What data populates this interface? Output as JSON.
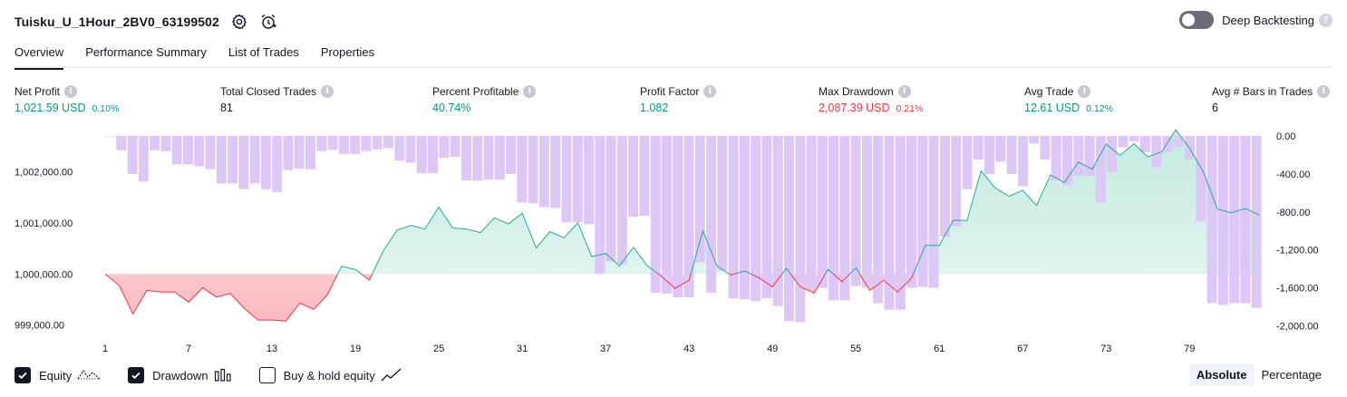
{
  "header": {
    "title": "Tuisku_U_1Hour_2BV0_63199502",
    "icons": [
      "settings-gear-icon",
      "alarm-add-icon"
    ]
  },
  "deep_backtesting": {
    "label": "Deep Backtesting",
    "enabled": false,
    "help_icon": "question-icon"
  },
  "tabs": [
    "Overview",
    "Performance Summary",
    "List of Trades",
    "Properties"
  ],
  "active_tab": "Overview",
  "metrics": [
    {
      "label": "Net Profit",
      "value": "1,021.59 USD",
      "pct": "0.10%",
      "color": "#089981"
    },
    {
      "label": "Total Closed Trades",
      "value": "81",
      "pct": "",
      "color": "#131722"
    },
    {
      "label": "Percent Profitable",
      "value": "40.74%",
      "pct": "",
      "color": "#089981"
    },
    {
      "label": "Profit Factor",
      "value": "1.082",
      "pct": "",
      "color": "#089981"
    },
    {
      "label": "Max Drawdown",
      "value": "2,087.39 USD",
      "pct": "0.21%",
      "color": "#f23645"
    },
    {
      "label": "Avg Trade",
      "value": "12.61 USD",
      "pct": "0.12%",
      "color": "#089981"
    },
    {
      "label": "Avg # Bars in Trades",
      "value": "6",
      "pct": "",
      "color": "#131722"
    }
  ],
  "chart_data": {
    "type": "line",
    "baseline": 1000000,
    "left_axis": {
      "ticks": [
        999000,
        1000000,
        1001000,
        1002000
      ],
      "tick_labels": [
        "999,000.00",
        "1,000,000.00",
        "1,001,000.00",
        "1,002,000.00"
      ],
      "range": [
        998800,
        1002700
      ]
    },
    "right_axis": {
      "ticks": [
        0,
        -400,
        -800,
        -1200,
        -1600,
        -2000
      ],
      "tick_labels": [
        "0.00",
        "-400.00",
        "-800.00",
        "-1,200.00",
        "-1,600.00",
        "-2,000.00"
      ],
      "range": [
        -2100,
        0
      ]
    },
    "x_ticks": [
      1,
      7,
      13,
      19,
      25,
      31,
      37,
      43,
      49,
      55,
      61,
      67,
      73,
      79
    ],
    "series": [
      {
        "name": "Equity",
        "values": [
          1000000,
          999780,
          999220,
          999680,
          999650,
          999650,
          999450,
          999730,
          999550,
          999620,
          999330,
          999100,
          999100,
          999080,
          999430,
          999310,
          999600,
          1000150,
          1000090,
          999880,
          1000450,
          1000860,
          1000950,
          1000880,
          1001310,
          1000900,
          1000880,
          1000810,
          1001100,
          1000980,
          1001190,
          1000510,
          1000830,
          1000710,
          1001000,
          1000340,
          1000400,
          1000160,
          1000520,
          1000160,
          999960,
          999720,
          999880,
          1000850,
          1000160,
          999980,
          1000060,
          999930,
          999750,
          1000110,
          999750,
          999630,
          1000090,
          999850,
          1000120,
          999680,
          999880,
          999650,
          999920,
          1000560,
          1000560,
          1001050,
          1001050,
          1002020,
          1001690,
          1001520,
          1001640,
          1001340,
          1001940,
          1001790,
          1002190,
          1002050,
          1002540,
          1002320,
          1002550,
          1002290,
          1002390,
          1002820,
          1002460,
          1001990,
          1001270,
          1001200,
          1001280,
          1001160
        ]
      },
      {
        "name": "Drawdown",
        "values": [
          0,
          -150,
          -400,
          -480,
          -150,
          -160,
          -300,
          -300,
          -320,
          -350,
          -500,
          -500,
          -560,
          -500,
          -560,
          -590,
          -360,
          -345,
          -350,
          -160,
          -145,
          -190,
          -190,
          -160,
          -140,
          -130,
          -260,
          -280,
          -390,
          -390,
          -230,
          -220,
          -470,
          -470,
          -460,
          -460,
          -400,
          -700,
          -710,
          -750,
          -760,
          -910,
          -910,
          -930,
          -1450,
          -1320,
          -1350,
          -850,
          -840,
          -1650,
          -1660,
          -1700,
          -1700,
          -1330,
          -1650,
          -1420,
          -1710,
          -1720,
          -1740,
          -1710,
          -1790,
          -1950,
          -1960,
          -1600,
          -1600,
          -1730,
          -1730,
          -1580,
          -1600,
          -1760,
          -1830,
          -1830,
          -1600,
          -1590,
          -1600,
          -1060,
          -950,
          -560,
          -250,
          -400,
          -270,
          -400,
          -530,
          -80,
          -250,
          -470,
          -520,
          -420,
          -420,
          -700,
          -380,
          -120,
          -60,
          -170,
          -330,
          -170,
          -110,
          -250,
          -900,
          -1760,
          -1780,
          -1760,
          -1760,
          -1810
        ]
      }
    ]
  },
  "legend": [
    {
      "label": "Equity",
      "checked": true,
      "icon": "equity-line-icon"
    },
    {
      "label": "Drawdown",
      "checked": true,
      "icon": "drawdown-bars-icon"
    },
    {
      "label": "Buy & hold equity",
      "checked": false,
      "icon": "buy-hold-line-icon"
    }
  ],
  "mode": {
    "options": [
      "Absolute",
      "Percentage"
    ],
    "active": "Absolute"
  }
}
